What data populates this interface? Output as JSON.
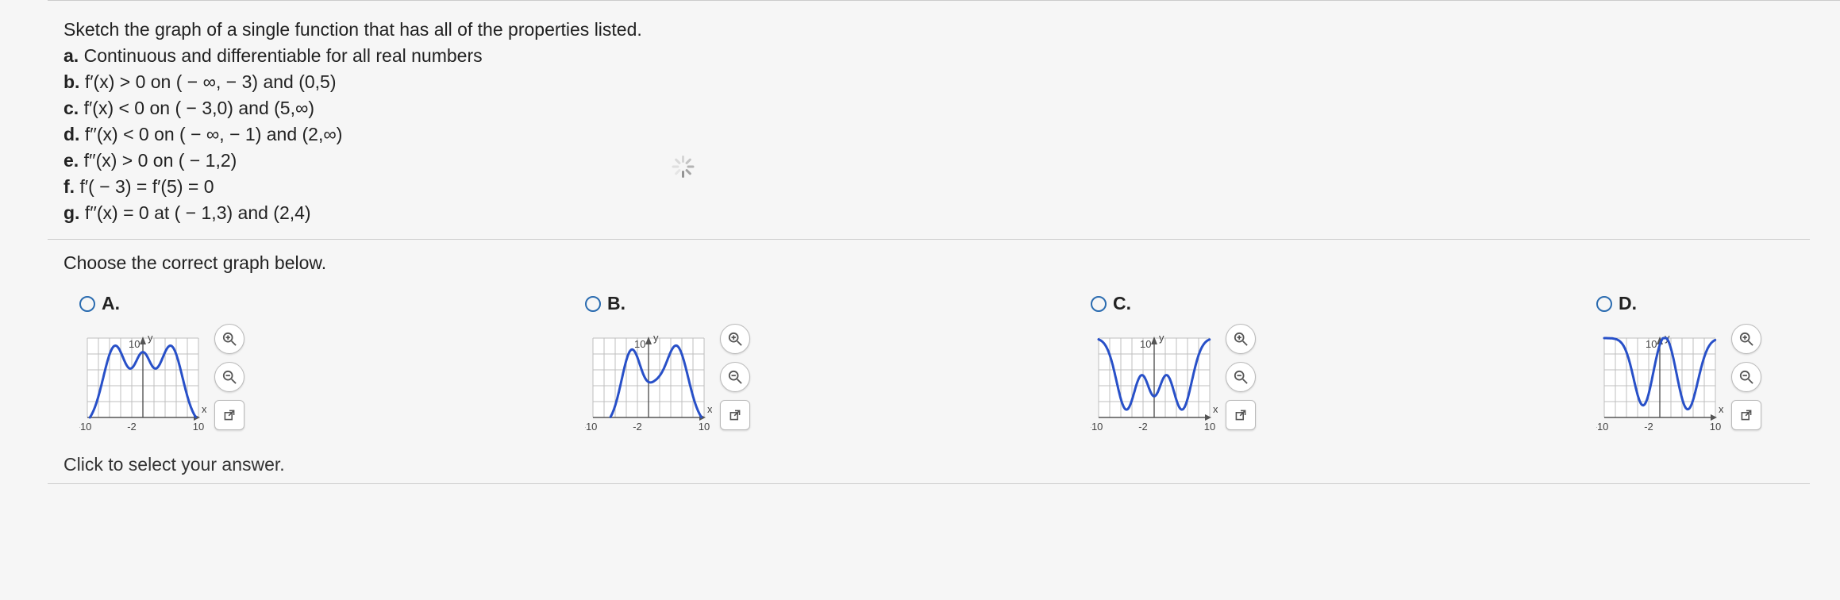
{
  "stem": {
    "intro": "Sketch the graph of a single function that has all of the properties listed.",
    "a": "Continuous and differentiable for all real numbers",
    "b": "f′(x) > 0 on ( − ∞, − 3) and (0,5)",
    "c": "f′(x) < 0 on ( − 3,0) and (5,∞)",
    "d": "f′′(x) < 0 on ( − ∞, − 1) and (2,∞)",
    "e": "f′′(x) > 0 on ( − 1,2)",
    "f": "f′( − 3) = f′(5) = 0",
    "g": "f′′(x) = 0 at ( − 1,3) and (2,4)"
  },
  "question": "Choose the correct graph below.",
  "options": [
    {
      "label": "A.",
      "graph": "A"
    },
    {
      "label": "B.",
      "graph": "B"
    },
    {
      "label": "C.",
      "graph": "C"
    },
    {
      "label": "D.",
      "graph": "D"
    }
  ],
  "axisLabels": {
    "x": "x",
    "y": "y",
    "xmin": "-10",
    "xneg": "-2",
    "xmax": "10",
    "ytick": "10"
  },
  "icons": {
    "zoomIn": "zoom-in-icon",
    "zoomOut": "zoom-out-icon",
    "popout": "popout-icon"
  },
  "footer": "Click to select your answer."
}
